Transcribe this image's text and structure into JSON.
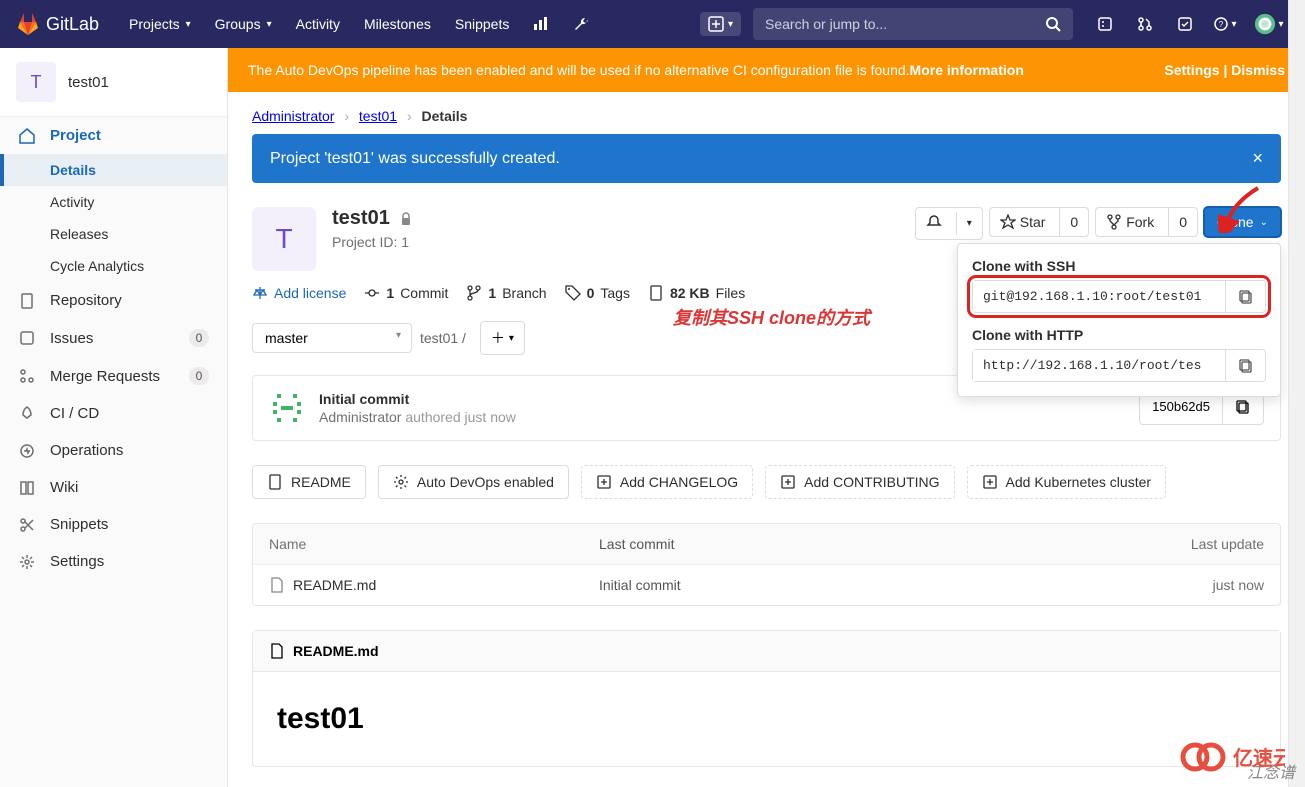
{
  "topnav": {
    "brand": "GitLab",
    "projects": "Projects",
    "groups": "Groups",
    "activity": "Activity",
    "milestones": "Milestones",
    "snippets": "Snippets",
    "search_placeholder": "Search or jump to..."
  },
  "sidebar": {
    "project_letter": "T",
    "project_name": "test01",
    "items": [
      {
        "label": "Project"
      },
      {
        "label": "Details",
        "sub": true,
        "active": true
      },
      {
        "label": "Activity",
        "sub": true
      },
      {
        "label": "Releases",
        "sub": true
      },
      {
        "label": "Cycle Analytics",
        "sub": true
      },
      {
        "label": "Repository"
      },
      {
        "label": "Issues",
        "badge": "0"
      },
      {
        "label": "Merge Requests",
        "badge": "0"
      },
      {
        "label": "CI / CD"
      },
      {
        "label": "Operations"
      },
      {
        "label": "Wiki"
      },
      {
        "label": "Snippets"
      },
      {
        "label": "Settings"
      }
    ]
  },
  "banner": {
    "text": "The Auto DevOps pipeline has been enabled and will be used if no alternative CI configuration file is found. ",
    "more": "More information",
    "settings": "Settings",
    "dismiss": "Dismiss"
  },
  "crumbs": {
    "a": "Administrator",
    "b": "test01",
    "c": "Details"
  },
  "alert": {
    "text": "Project 'test01' was successfully created."
  },
  "project": {
    "letter": "T",
    "name": "test01",
    "project_id_label": "Project ID: 1"
  },
  "actions": {
    "star": "Star",
    "star_count": "0",
    "fork": "Fork",
    "fork_count": "0",
    "clone": "Clone"
  },
  "clone": {
    "ssh_label": "Clone with SSH",
    "ssh_value": "git@192.168.1.10:root/test01",
    "http_label": "Clone with HTTP",
    "http_value": "http://192.168.1.10/root/tes"
  },
  "meta": {
    "add_license": "Add license",
    "commits": "Commit",
    "commits_n": "1",
    "branches": "Branch",
    "branches_n": "1",
    "tags": "Tags",
    "tags_n": "0",
    "size": "Files",
    "size_v": "82 KB"
  },
  "branch": {
    "name": "master",
    "path": "test01",
    "sep": "/"
  },
  "commit": {
    "title": "Initial commit",
    "author": "Administrator",
    "when": "authored just now",
    "sha": "150b62d5"
  },
  "qactions": {
    "readme": "README",
    "devops": "Auto DevOps enabled",
    "changelog": "Add CHANGELOG",
    "contrib": "Add CONTRIBUTING",
    "k8s": "Add Kubernetes cluster"
  },
  "ftable": {
    "h1": "Name",
    "h2": "Last commit",
    "h3": "Last update",
    "r1_name": "README.md",
    "r1_commit": "Initial commit",
    "r1_time": "just now"
  },
  "readme": {
    "file": "README.md",
    "title": "test01"
  },
  "annotation": "复制其SSH clone的方式",
  "watermark": "江念谱",
  "watermark2": "亿速云"
}
